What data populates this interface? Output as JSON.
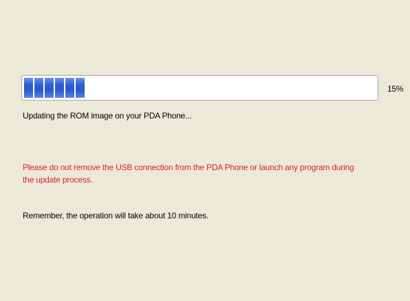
{
  "progress": {
    "percent_label": "15%",
    "fraction": 0.15,
    "segments": 6,
    "fill_color": "#2C5FD4"
  },
  "messages": {
    "status": "Updating the ROM image on your PDA Phone...",
    "warning": "Please do not remove the USB connection from the PDA Phone or launch any program during the update process.",
    "remember": "Remember, the operation will take about 10 minutes."
  },
  "colors": {
    "background": "#ECE9D8",
    "warning": "#D4242A"
  }
}
